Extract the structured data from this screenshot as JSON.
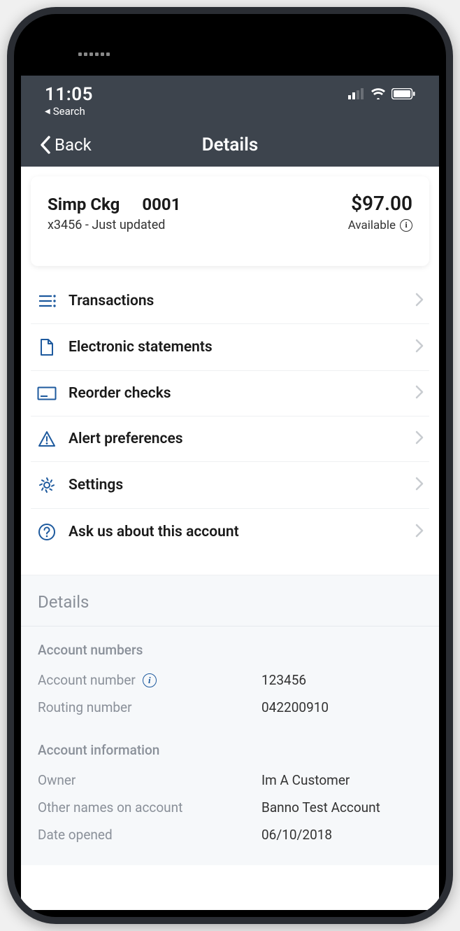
{
  "status": {
    "time": "11:05",
    "breadcrumb": "Search"
  },
  "nav": {
    "back": "Back",
    "title": "Details"
  },
  "account": {
    "name_part1": "Simp Ckg",
    "name_part2": "0001",
    "masked": "x3456",
    "updated": "Just updated",
    "balance": "$97.00",
    "available_label": "Available"
  },
  "menu": [
    {
      "key": "transactions",
      "label": "Transactions",
      "icon": "list"
    },
    {
      "key": "statements",
      "label": "Electronic statements",
      "icon": "doc"
    },
    {
      "key": "reorder",
      "label": "Reorder checks",
      "icon": "card"
    },
    {
      "key": "alerts",
      "label": "Alert preferences",
      "icon": "alert"
    },
    {
      "key": "settings",
      "label": "Settings",
      "icon": "gear"
    },
    {
      "key": "ask",
      "label": "Ask us about this account",
      "icon": "help"
    }
  ],
  "details": {
    "section_title": "Details",
    "account_numbers": {
      "title": "Account numbers",
      "number_label": "Account number",
      "number_value": "123456",
      "routing_label": "Routing number",
      "routing_value": "042200910"
    },
    "account_info": {
      "title": "Account information",
      "owner_label": "Owner",
      "owner_value": "Im A Customer",
      "other_label": "Other names on account",
      "other_value": "Banno Test Account",
      "opened_label": "Date opened",
      "opened_value": "06/10/2018"
    }
  }
}
